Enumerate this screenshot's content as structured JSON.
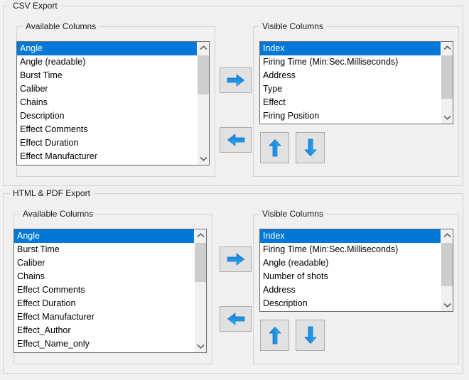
{
  "window": {
    "title": "Export Column Settings",
    "background_color": "#f0f0f0",
    "selection_color": "#0078d7",
    "accent_arrow_color": "#1a93e8"
  },
  "sections": [
    {
      "id": "csv-export",
      "title": "CSV Export",
      "available": {
        "group_label": "Available Columns",
        "items": [
          "Angle",
          "Angle (readable)",
          "Burst Time",
          "Caliber",
          "Chains",
          "Description",
          "Effect Comments",
          "Effect Duration",
          "Effect Manufacturer"
        ],
        "selected_index": 0
      },
      "visible": {
        "group_label": "Visible Columns",
        "items": [
          "Index",
          "Firing Time (Min:Sec.Milliseconds)",
          "Address",
          "Type",
          "Effect",
          "Firing Position"
        ],
        "selected_index": 0
      },
      "buttons": {
        "add_label": "right-arrow",
        "remove_label": "left-arrow",
        "move_up_label": "up-arrow",
        "move_down_label": "down-arrow"
      }
    },
    {
      "id": "html-pdf-export",
      "title": "HTML & PDF Export",
      "available": {
        "group_label": "Available Columns",
        "items": [
          "Angle",
          "Burst Time",
          "Caliber",
          "Chains",
          "Effect Comments",
          "Effect Duration",
          "Effect Manufacturer",
          "Effect_Author",
          "Effect_Name_only"
        ],
        "selected_index": 0
      },
      "visible": {
        "group_label": "Visible Columns",
        "items": [
          "Index",
          "Firing Time (Min:Sec.Milliseconds)",
          "Angle (readable)",
          "Number of shots",
          "Address",
          "Description"
        ],
        "selected_index": 0
      },
      "buttons": {
        "add_label": "right-arrow",
        "remove_label": "left-arrow",
        "move_up_label": "up-arrow",
        "move_down_label": "down-arrow"
      }
    }
  ],
  "icons": {
    "scroll_up": "chevron-up-icon",
    "scroll_down": "chevron-down-icon",
    "add": "arrow-right-icon",
    "remove": "arrow-left-icon",
    "move_up": "arrow-up-icon",
    "move_down": "arrow-down-icon"
  }
}
